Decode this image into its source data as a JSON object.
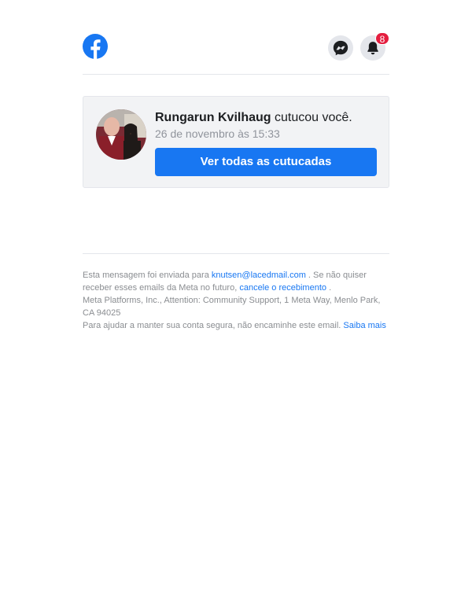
{
  "header": {
    "notification_count": "8",
    "brand_color": "#1877f2"
  },
  "notification": {
    "actor_name": "Rungarun Kvilhaug",
    "action_text": " cutucou você.",
    "date": "26 de novembro às 15:33",
    "button_label": "Ver todas as cutucadas"
  },
  "footer": {
    "sent_to_prefix": "Esta mensagem foi enviada para ",
    "email": "knutsen@lacedmail.com",
    "unsubscribe_prefix": " . Se não quiser receber esses emails da Meta no futuro, ",
    "unsubscribe_link": "cancele o recebimento",
    "unsubscribe_suffix": " .",
    "address": "Meta Platforms, Inc., Attention: Community Support, 1 Meta Way, Menlo Park, CA 94025",
    "security_text": "Para ajudar a manter sua conta segura, não encaminhe este email. ",
    "learn_more_link": "Saiba mais"
  }
}
